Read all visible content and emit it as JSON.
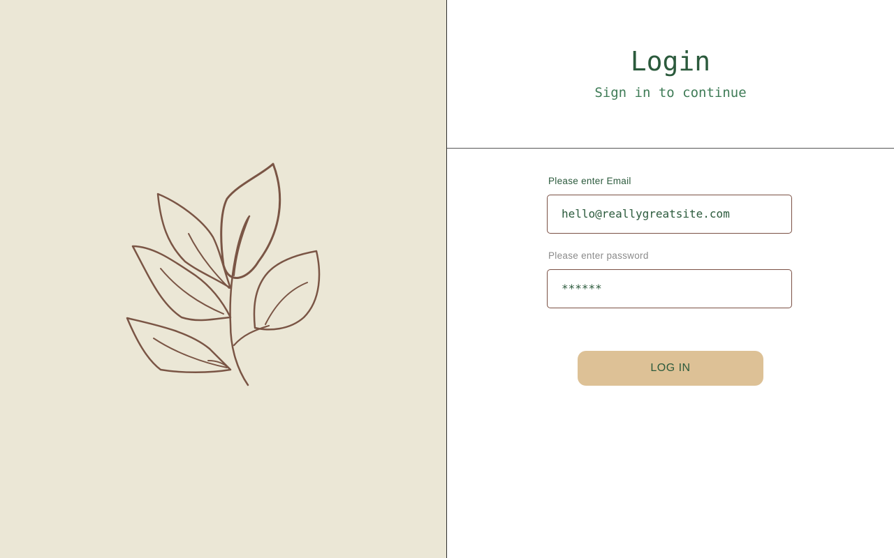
{
  "left_panel": {
    "background_color": "#ebe7d6",
    "illustration_icon": "leaf-branch-icon",
    "stroke_color": "#7a5545"
  },
  "header": {
    "title": "Login",
    "subtitle": "Sign in to continue"
  },
  "form": {
    "email_label": "Please enter Email",
    "email_value": "hello@reallygreatsite.com",
    "password_label": "Please enter password",
    "password_value": "******",
    "submit_label": "LOG IN"
  },
  "colors": {
    "accent_green": "#2b5a3c",
    "button_bg": "#ddc196",
    "field_border": "#7a4f43"
  }
}
